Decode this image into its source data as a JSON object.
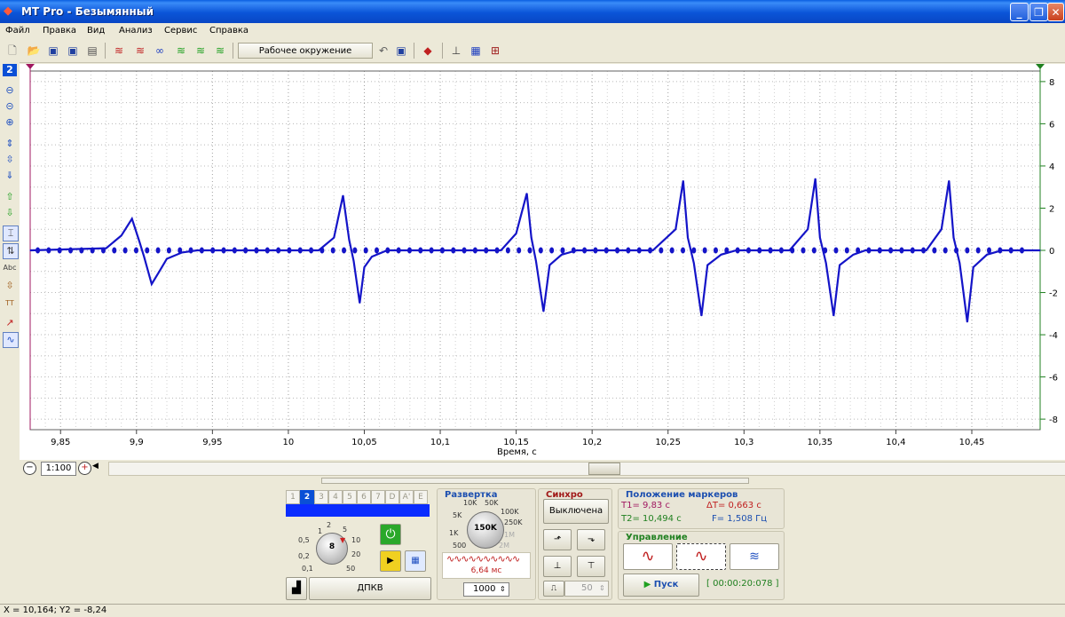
{
  "window": {
    "title": "MT Pro - Безымянный"
  },
  "menu": [
    "Файл",
    "Правка",
    "Вид",
    "Анализ",
    "Сервис",
    "Справка"
  ],
  "toolbar": {
    "workspace": "Рабочее окружение"
  },
  "left_toolbar": {
    "channel": "2"
  },
  "chart_data": {
    "type": "line",
    "xlabel": "Время, с",
    "xlim": [
      9.83,
      10.495
    ],
    "ylim": [
      -8.5,
      8.5
    ],
    "x_ticks": [
      "9,85",
      "9,9",
      "9,95",
      "10",
      "10,05",
      "10,1",
      "10,15",
      "10,2",
      "10,25",
      "10,3",
      "10,35",
      "10,4",
      "10,45"
    ],
    "x_tick_values": [
      9.85,
      9.9,
      9.95,
      10.0,
      10.05,
      10.1,
      10.15,
      10.2,
      10.25,
      10.3,
      10.35,
      10.4,
      10.45
    ],
    "y_ticks": [
      "8",
      "6",
      "4",
      "2",
      "0",
      "-2",
      "-4",
      "-6",
      "-8"
    ],
    "y_tick_values": [
      8,
      6,
      4,
      2,
      0,
      -2,
      -4,
      -6,
      -8
    ],
    "grid": true,
    "color": "#1414c8",
    "series": [
      {
        "values": [
          [
            9.83,
            0
          ],
          [
            9.88,
            0.1
          ],
          [
            9.89,
            0.7
          ],
          [
            9.897,
            1.5
          ],
          [
            9.902,
            0.4
          ],
          [
            9.905,
            -0.3
          ],
          [
            9.91,
            -1.6
          ],
          [
            9.915,
            -1.0
          ],
          [
            9.92,
            -0.4
          ],
          [
            9.93,
            -0.1
          ],
          [
            9.94,
            0
          ],
          [
            10.02,
            0
          ],
          [
            10.03,
            0.6
          ],
          [
            10.036,
            2.6
          ],
          [
            10.04,
            0.5
          ],
          [
            10.043,
            -0.5
          ],
          [
            10.047,
            -2.5
          ],
          [
            10.05,
            -0.8
          ],
          [
            10.055,
            -0.3
          ],
          [
            10.065,
            0
          ],
          [
            10.14,
            0
          ],
          [
            10.15,
            0.8
          ],
          [
            10.157,
            2.7
          ],
          [
            10.16,
            0.6
          ],
          [
            10.163,
            -0.5
          ],
          [
            10.168,
            -2.9
          ],
          [
            10.172,
            -0.7
          ],
          [
            10.18,
            -0.2
          ],
          [
            10.19,
            0
          ],
          [
            10.24,
            0
          ],
          [
            10.255,
            1.0
          ],
          [
            10.26,
            3.3
          ],
          [
            10.263,
            0.6
          ],
          [
            10.267,
            -0.6
          ],
          [
            10.272,
            -3.1
          ],
          [
            10.276,
            -0.7
          ],
          [
            10.285,
            -0.2
          ],
          [
            10.295,
            0
          ],
          [
            10.33,
            0
          ],
          [
            10.342,
            1.0
          ],
          [
            10.347,
            3.4
          ],
          [
            10.35,
            0.6
          ],
          [
            10.354,
            -0.6
          ],
          [
            10.359,
            -3.1
          ],
          [
            10.363,
            -0.7
          ],
          [
            10.372,
            -0.2
          ],
          [
            10.38,
            0
          ],
          [
            10.42,
            0
          ],
          [
            10.43,
            1.0
          ],
          [
            10.435,
            3.3
          ],
          [
            10.438,
            0.6
          ],
          [
            10.442,
            -0.6
          ],
          [
            10.447,
            -3.4
          ],
          [
            10.451,
            -0.8
          ],
          [
            10.46,
            -0.2
          ],
          [
            10.47,
            0
          ],
          [
            10.495,
            0
          ]
        ]
      }
    ]
  },
  "scale": {
    "label": "1:100"
  },
  "channel_panel": {
    "tabs": [
      "1",
      "2",
      "3",
      "4",
      "5",
      "6",
      "7",
      "D",
      "A'",
      "E"
    ],
    "knob_labels": [
      "0,5",
      "1",
      "2",
      "5",
      "10",
      "20",
      "50",
      "0,2",
      "0,1"
    ],
    "knob_value": "8",
    "sensor": "ДПКВ"
  },
  "sweep": {
    "title": "Развертка",
    "knob_labels": [
      "10K",
      "50K",
      "5K",
      "100K",
      "250K",
      "1K",
      "1M",
      "500",
      "2M"
    ],
    "knob_value": "150K",
    "period": "6,64 мс",
    "samples": "1000"
  },
  "sync": {
    "title": "Синхро",
    "mode": "Выключена",
    "level": "50"
  },
  "markers": {
    "title": "Положение маркеров",
    "t1": "T1= 9,83 с",
    "t2": "T2= 10,494 с",
    "dt": "ΔT= 0,663 с",
    "f": "F= 1,508 Гц"
  },
  "control": {
    "title": "Управление",
    "start_label": "Пуск",
    "timer": "[ 00:00:20:078 ]"
  },
  "status": {
    "coords": "X = 10,164; Y2 = -8,24"
  }
}
